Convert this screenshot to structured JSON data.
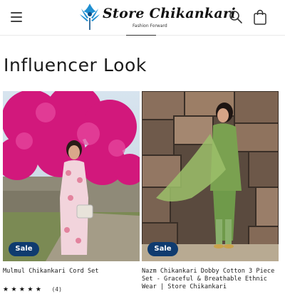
{
  "header": {
    "brand_name": "Store Chikankari",
    "brand_tagline": "Fashion Forward",
    "icons": {
      "menu": "hamburger-menu-icon",
      "search": "search-icon",
      "cart": "shopping-bag-icon",
      "logo_mark": "peacock-feather-icon"
    }
  },
  "page": {
    "title": "Influencer Look"
  },
  "products": [
    {
      "title": "Mulmul Chikankari Cord Set",
      "badge": "Sale",
      "rating_stars": "★★★★★",
      "rating_count": "(4)"
    },
    {
      "title": "Nazm Chikankari Dobby Cotton 3 Piece Set - Graceful & Breathable Ethnic Wear | Store Chikankari",
      "badge": "Sale"
    }
  ],
  "colors": {
    "badge": "#0f3b6f",
    "accent_logo": "#1f8fd1",
    "text": "#1a1a1a",
    "divider": "#e9e9e9"
  }
}
